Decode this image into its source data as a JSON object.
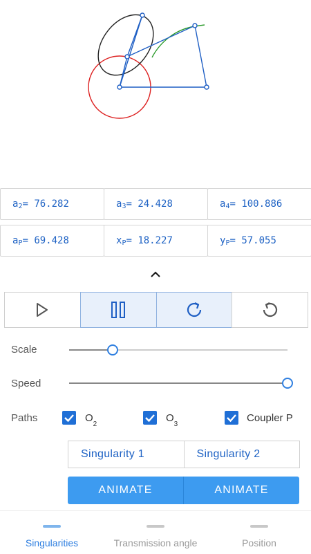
{
  "params": {
    "row1": [
      {
        "sym": "a",
        "sub": "2",
        "value": " = 76.282"
      },
      {
        "sym": "a",
        "sub": "3",
        "value": " = 24.428"
      },
      {
        "sym": "a",
        "sub": "4",
        "value": " = 100.886"
      }
    ],
    "row2": [
      {
        "sym": "a",
        "sub": "P",
        "value": " = 69.428"
      },
      {
        "sym": "x",
        "sub": "P",
        "value": " = 18.227"
      },
      {
        "sym": "y",
        "sub": "P",
        "value": " = 57.055"
      }
    ]
  },
  "playback": {
    "active": [
      "pause",
      "reload"
    ],
    "icons": [
      "play-icon",
      "pause-icon",
      "reload-icon",
      "reset-icon"
    ]
  },
  "controls": {
    "scale": {
      "label": "Scale",
      "value": 0.2
    },
    "speed": {
      "label": "Speed",
      "value": 1.0
    }
  },
  "paths": {
    "label": "Paths",
    "items": [
      {
        "base": "O",
        "sub": "2",
        "checked": true
      },
      {
        "base": "O",
        "sub": "3",
        "checked": true
      },
      {
        "base": "Coupler P",
        "sub": "",
        "checked": true
      }
    ]
  },
  "singularity": {
    "buttons": [
      "Singularity 1",
      "Singularity 2"
    ],
    "animate": [
      "ANIMATE",
      "ANIMATE"
    ]
  },
  "nav": {
    "items": [
      {
        "label": "Singularities",
        "active": true
      },
      {
        "label": "Transmission angle",
        "active": false
      },
      {
        "label": "Position",
        "active": false
      }
    ]
  },
  "colors": {
    "accent": "#1e62c4",
    "button": "#3d9bf0",
    "circle": "#dd2222",
    "coupler_curve": "#2a9a2a",
    "ellipse": "#222222"
  }
}
